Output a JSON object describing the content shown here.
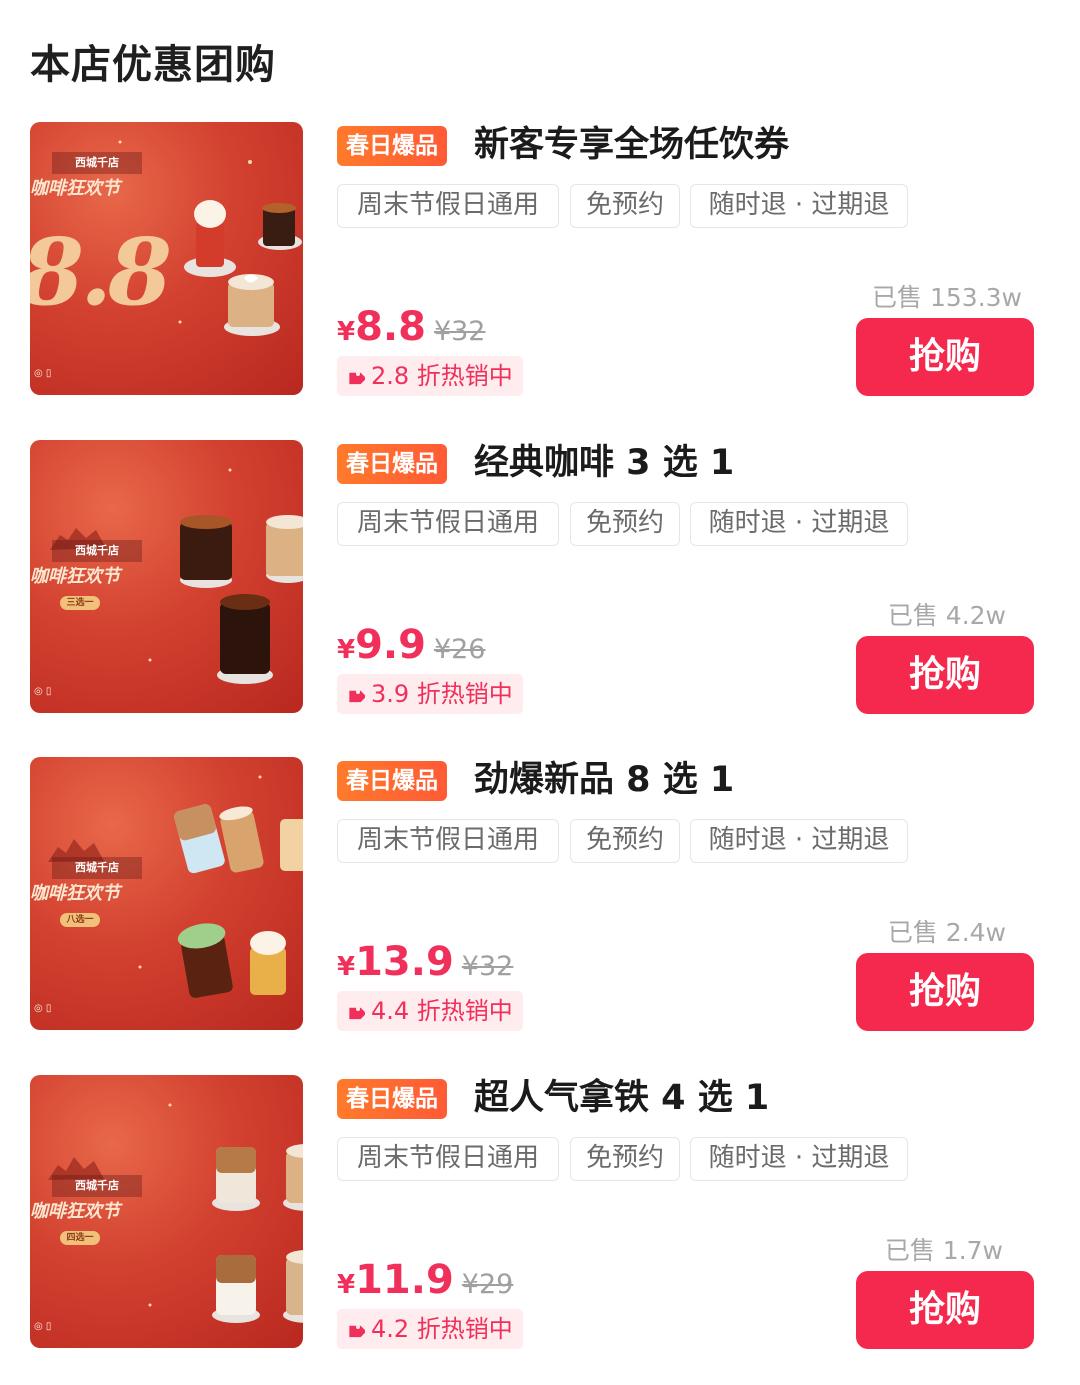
{
  "section": {
    "title": "本店优惠团购"
  },
  "theme": {
    "accent": "#f5284e",
    "badge_gradient": [
      "#ff7a2b",
      "#ff5a36"
    ],
    "thumb_red": "#d2402f"
  },
  "thumb_common": {
    "city_text": "西城千店",
    "festival_text": "咖啡狂欢节"
  },
  "deals": [
    {
      "badge": "春日爆品",
      "title": "新客专享全场任饮券",
      "tags": [
        "周末节假日通用",
        "免预约",
        "随时退 · 过期退"
      ],
      "sold": "已售 153.3w",
      "currency": "¥",
      "price": "8.8",
      "original_price": "¥32",
      "discount": "2.8 折热销中",
      "buy_label": "抢购",
      "thumb_big": "8.8"
    },
    {
      "badge": "春日爆品",
      "title": "经典咖啡 3 选 1",
      "tags": [
        "周末节假日通用",
        "免预约",
        "随时退 · 过期退"
      ],
      "sold": "已售 4.2w",
      "currency": "¥",
      "price": "9.9",
      "original_price": "¥26",
      "discount": "3.9 折热销中",
      "buy_label": "抢购",
      "thumb_pill": "三选一"
    },
    {
      "badge": "春日爆品",
      "title": "劲爆新品 8 选 1",
      "tags": [
        "周末节假日通用",
        "免预约",
        "随时退 · 过期退"
      ],
      "sold": "已售 2.4w",
      "currency": "¥",
      "price": "13.9",
      "original_price": "¥32",
      "discount": "4.4 折热销中",
      "buy_label": "抢购",
      "thumb_pill": "八选一"
    },
    {
      "badge": "春日爆品",
      "title": "超人气拿铁 4 选 1",
      "tags": [
        "周末节假日通用",
        "免预约",
        "随时退 · 过期退"
      ],
      "sold": "已售 1.7w",
      "currency": "¥",
      "price": "11.9",
      "original_price": "¥29",
      "discount": "4.2 折热销中",
      "buy_label": "抢购",
      "thumb_pill": "四选一"
    }
  ]
}
